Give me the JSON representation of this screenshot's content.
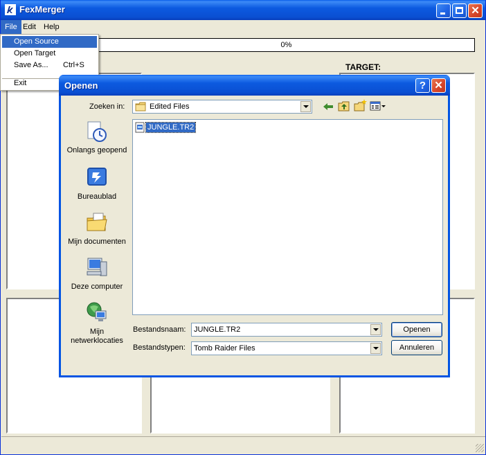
{
  "app": {
    "title": "FexMerger"
  },
  "menubar": {
    "file": "File",
    "edit": "Edit",
    "help": "Help"
  },
  "file_menu": {
    "open_source": "Open Source",
    "open_target": "Open Target",
    "save_as": "Save As...",
    "save_as_shortcut": "Ctrl+S",
    "exit": "Exit"
  },
  "progress": {
    "text": "0%",
    "value": 0
  },
  "target_label": "TARGET:",
  "dialog": {
    "title": "Openen",
    "help_glyph": "?",
    "look_in_label": "Zoeken in:",
    "look_in_value": "Edited Files",
    "places": [
      {
        "label": "Onlangs geopend",
        "icon": "recent-documents-icon"
      },
      {
        "label": "Bureaublad",
        "icon": "desktop-icon"
      },
      {
        "label": "Mijn documenten",
        "icon": "my-documents-icon"
      },
      {
        "label": "Deze computer",
        "icon": "my-computer-icon"
      },
      {
        "label": "Mijn netwerklocaties",
        "icon": "network-places-icon"
      }
    ],
    "files": [
      {
        "name": "JUNGLE.TR2"
      }
    ],
    "filename_label": "Bestandsnaam:",
    "filename_value": "JUNGLE.TR2",
    "filetype_label": "Bestandstypen:",
    "filetype_value": "Tomb Raider Files",
    "open_button": "Openen",
    "cancel_button": "Annuleren"
  },
  "colors": {
    "titlebar": "#0A4FD2",
    "selection": "#316AC5",
    "face": "#ECE9D8",
    "close": "#D6452A"
  }
}
